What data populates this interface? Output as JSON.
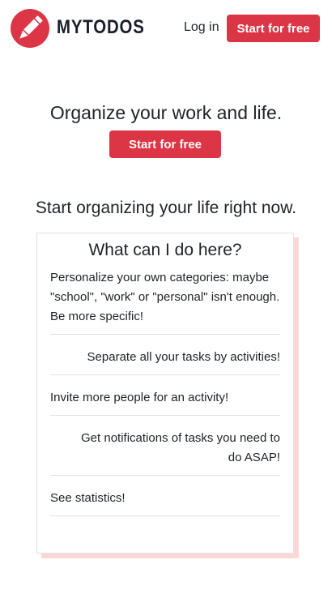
{
  "header": {
    "brand": "MYTODOS",
    "login": "Log in",
    "cta": "Start for free"
  },
  "hero": {
    "title": "Organize your work and life.",
    "cta": "Start for free"
  },
  "subtitle": "Start organizing your life right now.",
  "card": {
    "title": "What can I do here?",
    "items": [
      "Personalize your own categories: maybe \"school\", \"work\" or \"personal\" isn't enough. Be more specific!",
      "Separate all your tasks by activities!",
      "Invite more people for an activity!",
      "Get notifications of tasks you need to do ASAP!",
      "See statistics!"
    ]
  },
  "colors": {
    "accent": "#dc3545",
    "shadow": "#ffd6d6"
  }
}
